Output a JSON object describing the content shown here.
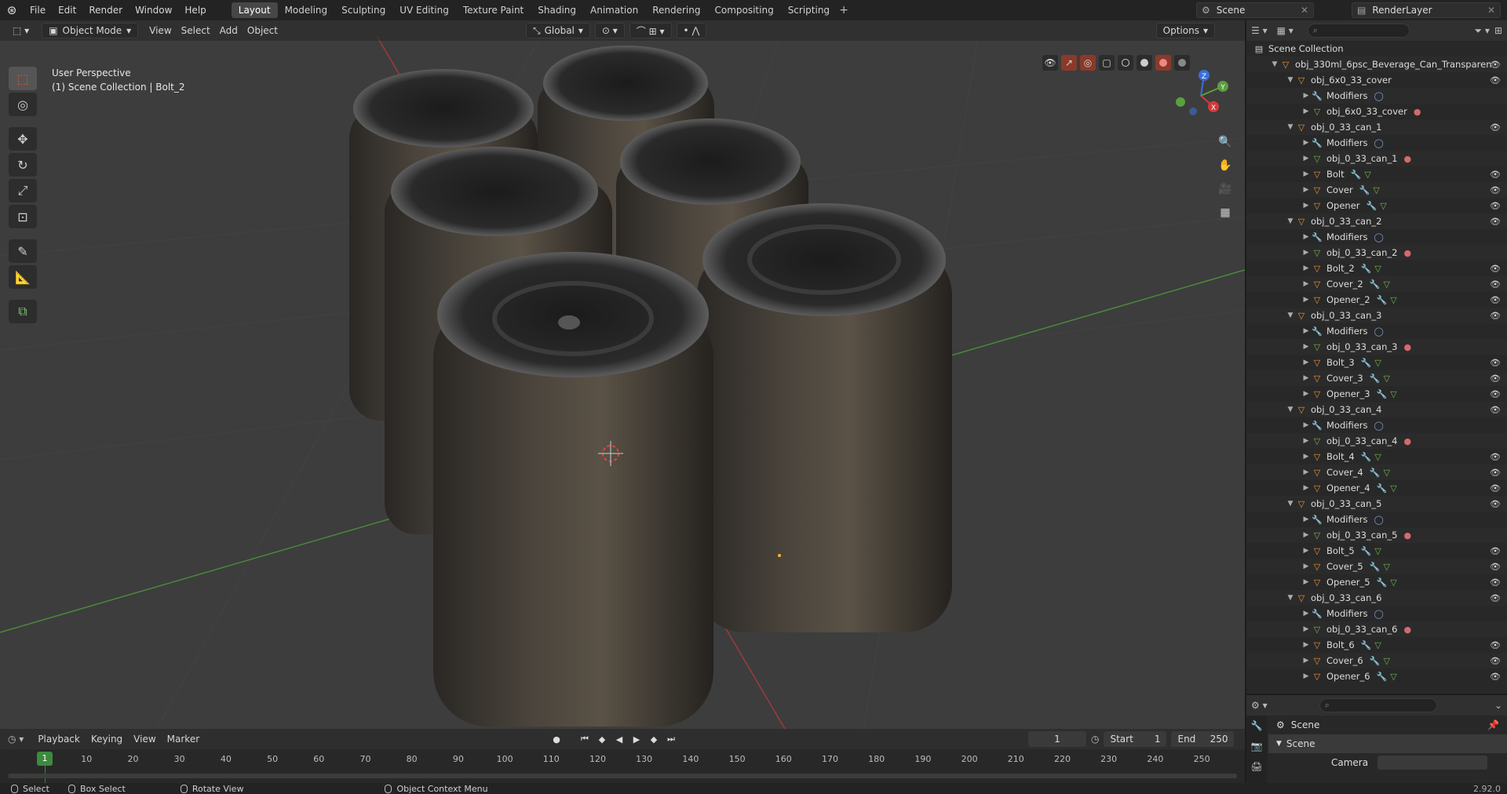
{
  "menubar": {
    "items": [
      "File",
      "Edit",
      "Render",
      "Window",
      "Help"
    ],
    "workspaces": [
      "Layout",
      "Modeling",
      "Sculpting",
      "UV Editing",
      "Texture Paint",
      "Shading",
      "Animation",
      "Rendering",
      "Compositing",
      "Scripting"
    ],
    "active_workspace": "Layout",
    "scene": "Scene",
    "view_layer": "RenderLayer"
  },
  "viewport": {
    "mode": "Object Mode",
    "menus": [
      "View",
      "Select",
      "Add",
      "Object"
    ],
    "orientation": "Global",
    "options_label": "Options",
    "perspective_label": "User Perspective",
    "context_label": "(1) Scene Collection | Bolt_2"
  },
  "tools": [
    "select-box",
    "cursor",
    "move",
    "rotate",
    "scale",
    "transform",
    "annotate",
    "measure",
    "add-cube"
  ],
  "gizmo": {
    "z": "Z",
    "y": "Y",
    "x": "X"
  },
  "outliner": {
    "root": "Scene Collection",
    "rows": [
      {
        "indent": 1,
        "type": "obj",
        "label": "obj_330ml_6psc_Beverage_Can_Transparen",
        "eye": true
      },
      {
        "indent": 2,
        "type": "obj",
        "label": "obj_6x0_33_cover",
        "eye": true
      },
      {
        "indent": 3,
        "type": "mod",
        "label": "Modifiers"
      },
      {
        "indent": 3,
        "type": "mesh",
        "label": "obj_6x0_33_cover",
        "mat": true
      },
      {
        "indent": 2,
        "type": "obj",
        "label": "obj_0_33_can_1",
        "eye": true
      },
      {
        "indent": 3,
        "type": "mod",
        "label": "Modifiers"
      },
      {
        "indent": 3,
        "type": "mesh",
        "label": "obj_0_33_can_1",
        "mat": true
      },
      {
        "indent": 3,
        "type": "obj",
        "label": "Bolt",
        "eye": true
      },
      {
        "indent": 3,
        "type": "obj",
        "label": "Cover",
        "eye": true
      },
      {
        "indent": 3,
        "type": "obj",
        "label": "Opener",
        "eye": true
      },
      {
        "indent": 2,
        "type": "obj",
        "label": "obj_0_33_can_2",
        "eye": true
      },
      {
        "indent": 3,
        "type": "mod",
        "label": "Modifiers"
      },
      {
        "indent": 3,
        "type": "mesh",
        "label": "obj_0_33_can_2",
        "mat": true
      },
      {
        "indent": 3,
        "type": "obj",
        "label": "Bolt_2",
        "eye": true
      },
      {
        "indent": 3,
        "type": "obj",
        "label": "Cover_2",
        "eye": true
      },
      {
        "indent": 3,
        "type": "obj",
        "label": "Opener_2",
        "eye": true
      },
      {
        "indent": 2,
        "type": "obj",
        "label": "obj_0_33_can_3",
        "eye": true
      },
      {
        "indent": 3,
        "type": "mod",
        "label": "Modifiers"
      },
      {
        "indent": 3,
        "type": "mesh",
        "label": "obj_0_33_can_3",
        "mat": true
      },
      {
        "indent": 3,
        "type": "obj",
        "label": "Bolt_3",
        "eye": true
      },
      {
        "indent": 3,
        "type": "obj",
        "label": "Cover_3",
        "eye": true
      },
      {
        "indent": 3,
        "type": "obj",
        "label": "Opener_3",
        "eye": true
      },
      {
        "indent": 2,
        "type": "obj",
        "label": "obj_0_33_can_4",
        "eye": true
      },
      {
        "indent": 3,
        "type": "mod",
        "label": "Modifiers"
      },
      {
        "indent": 3,
        "type": "mesh",
        "label": "obj_0_33_can_4",
        "mat": true
      },
      {
        "indent": 3,
        "type": "obj",
        "label": "Bolt_4",
        "eye": true
      },
      {
        "indent": 3,
        "type": "obj",
        "label": "Cover_4",
        "eye": true
      },
      {
        "indent": 3,
        "type": "obj",
        "label": "Opener_4",
        "eye": true
      },
      {
        "indent": 2,
        "type": "obj",
        "label": "obj_0_33_can_5",
        "eye": true
      },
      {
        "indent": 3,
        "type": "mod",
        "label": "Modifiers"
      },
      {
        "indent": 3,
        "type": "mesh",
        "label": "obj_0_33_can_5",
        "mat": true
      },
      {
        "indent": 3,
        "type": "obj",
        "label": "Bolt_5",
        "eye": true
      },
      {
        "indent": 3,
        "type": "obj",
        "label": "Cover_5",
        "eye": true
      },
      {
        "indent": 3,
        "type": "obj",
        "label": "Opener_5",
        "eye": true
      },
      {
        "indent": 2,
        "type": "obj",
        "label": "obj_0_33_can_6",
        "eye": true
      },
      {
        "indent": 3,
        "type": "mod",
        "label": "Modifiers"
      },
      {
        "indent": 3,
        "type": "mesh",
        "label": "obj_0_33_can_6",
        "mat": true
      },
      {
        "indent": 3,
        "type": "obj",
        "label": "Bolt_6",
        "eye": true
      },
      {
        "indent": 3,
        "type": "obj",
        "label": "Cover_6",
        "eye": true
      },
      {
        "indent": 3,
        "type": "obj",
        "label": "Opener_6",
        "eye": true
      }
    ]
  },
  "properties": {
    "context": "Scene",
    "panel_title": "Scene",
    "camera_label": "Camera",
    "version": "2.92.0"
  },
  "timeline": {
    "menus": [
      "Playback",
      "Keying",
      "View",
      "Marker"
    ],
    "current_frame": "1",
    "start_label": "Start",
    "start_value": "1",
    "end_label": "End",
    "end_value": "250",
    "ticks": [
      "10",
      "20",
      "30",
      "40",
      "50",
      "60",
      "70",
      "80",
      "90",
      "100",
      "110",
      "120",
      "130",
      "140",
      "150",
      "160",
      "170",
      "180",
      "190",
      "200",
      "210",
      "220",
      "230",
      "240",
      "250"
    ],
    "cursor_label": "1"
  },
  "statusbar": {
    "select": "Select",
    "box_select": "Box Select",
    "rotate_view": "Rotate View",
    "context_menu": "Object Context Menu"
  },
  "colors": {
    "accent": "#e8943a",
    "mesh": "#75b34f",
    "active_tool": "#e2592a",
    "frame_cursor": "#3d8a3d"
  }
}
